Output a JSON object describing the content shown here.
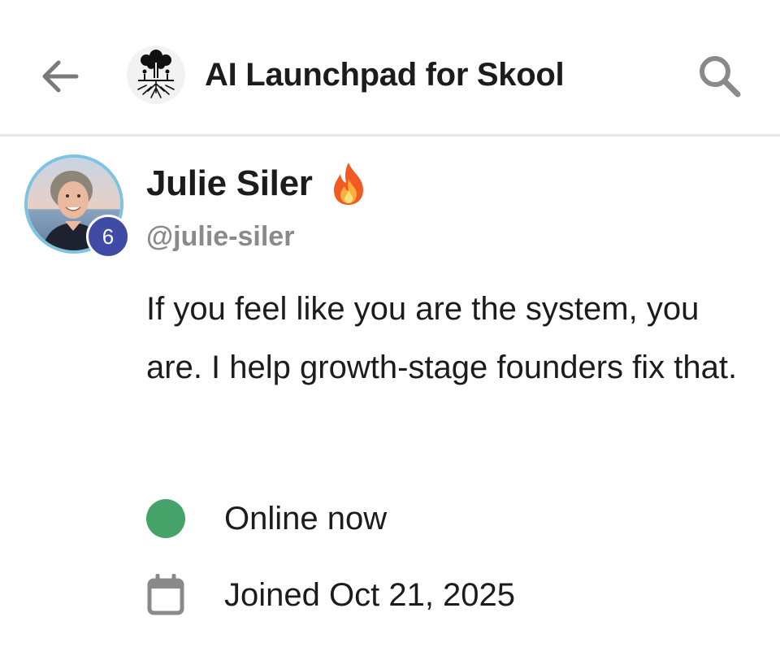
{
  "header": {
    "title": "AI Launchpad for Skool",
    "back_icon": "arrow-left-icon",
    "search_icon": "search-icon",
    "logo_icon": "tree-logo-icon"
  },
  "profile": {
    "name": "Julie Siler",
    "name_emoji": "🔥",
    "handle": "@julie-siler",
    "level": "6",
    "bio": "If you feel like you are the system, you are. I help growth-stage founders fix that.",
    "status": "Online now",
    "joined": "Joined Oct 21, 2025"
  },
  "colors": {
    "online": "#45a36a",
    "level_badge": "#3f4ba5",
    "avatar_ring": "#7fc3e3",
    "handle_text": "#8a8a8a",
    "icon_gray": "#8a8a8a"
  }
}
